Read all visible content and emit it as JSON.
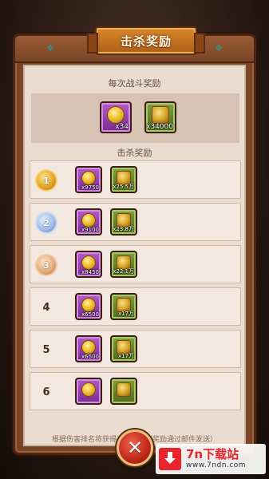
{
  "dialog": {
    "title": "击杀奖励",
    "battle_label": "每次战斗奖励",
    "kill_label": "击杀奖励",
    "footer": "根据伤害排名将获得对应奖励（奖励通过邮件发送）",
    "close_glyph": "✕"
  },
  "battle_rewards": [
    {
      "type": "purple-coin",
      "qty": "x34"
    },
    {
      "type": "green-coin",
      "qty": "x34000"
    }
  ],
  "kill_rewards": [
    {
      "rank": "1",
      "medal": "gold",
      "items": [
        {
          "type": "purple-coin",
          "qty": "x9750"
        },
        {
          "type": "green-coin",
          "qty": "x25.5万"
        }
      ]
    },
    {
      "rank": "2",
      "medal": "silver",
      "items": [
        {
          "type": "purple-coin",
          "qty": "x9100"
        },
        {
          "type": "green-coin",
          "qty": "x23.8万"
        }
      ]
    },
    {
      "rank": "3",
      "medal": "bronze",
      "items": [
        {
          "type": "purple-coin",
          "qty": "x8450"
        },
        {
          "type": "green-coin",
          "qty": "x22.1万"
        }
      ]
    },
    {
      "rank": "4",
      "medal": "",
      "items": [
        {
          "type": "purple-coin",
          "qty": "x6500"
        },
        {
          "type": "green-coin",
          "qty": "x17万"
        }
      ]
    },
    {
      "rank": "5",
      "medal": "",
      "items": [
        {
          "type": "purple-coin",
          "qty": "x6500"
        },
        {
          "type": "green-coin",
          "qty": "x17万"
        }
      ]
    },
    {
      "rank": "6",
      "medal": "",
      "items": [
        {
          "type": "purple-coin",
          "qty": ""
        },
        {
          "type": "green-coin",
          "qty": ""
        }
      ]
    }
  ],
  "watermark": {
    "main": "7n下载站",
    "sub": "www.7ndn.com"
  },
  "colors": {
    "board": "#7a4628",
    "paper": "#eadccf",
    "title_plaque": "#d8882c",
    "close_button": "#c02818",
    "watermark_red": "#e8252a"
  }
}
